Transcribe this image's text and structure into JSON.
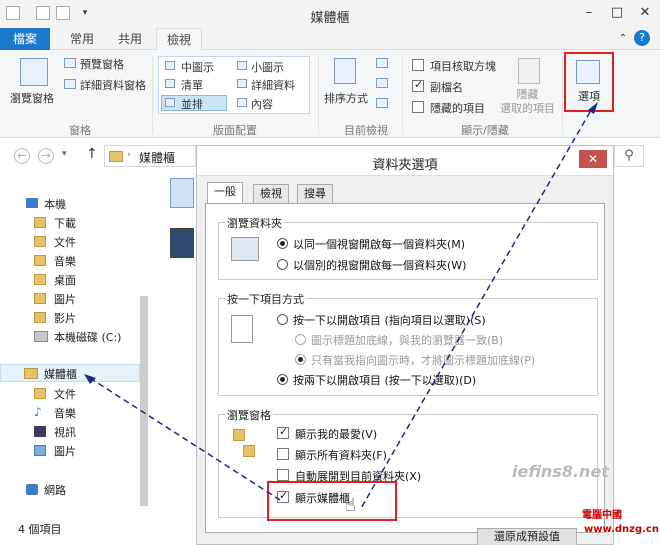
{
  "window": {
    "title": "媒體櫃"
  },
  "tabs": [
    "檔案",
    "常用",
    "共用",
    "檢視"
  ],
  "ribbon": {
    "panes": {
      "nav_pane": "瀏覽窗格",
      "preview_pane": "預覽窗格",
      "details_pane": "詳細資料窗格",
      "group": "窗格"
    },
    "layout": {
      "medium_icons": "中圖示",
      "small_icons": "小圖示",
      "list": "清單",
      "details": "詳細資料",
      "tiles": "並排",
      "content": "內容",
      "group": "版面配置"
    },
    "current_view": {
      "sort_by": "排序方式",
      "group": "目前檢視"
    },
    "show_hide": {
      "item_checkboxes": "項目核取方塊",
      "file_extensions": "副檔名",
      "hidden_items": "隱藏的項目",
      "hide_selected": "隱藏\n選取的項目",
      "group": "顯示/隱藏"
    },
    "options": "選項",
    "item_checkboxes_checked": false,
    "file_extensions_checked": true,
    "hidden_items_checked": false
  },
  "address": {
    "path": "媒體櫃"
  },
  "nav": {
    "this_pc": "本機",
    "items": [
      "下載",
      "文件",
      "音樂",
      "桌面",
      "圖片",
      "影片",
      "本機磁碟 (C:)"
    ],
    "libraries": "媒體櫃",
    "lib_items": [
      "文件",
      "音樂",
      "視訊",
      "圖片"
    ],
    "network": "網路"
  },
  "status": {
    "count": "4 個項目"
  },
  "dialog": {
    "title": "資料夾選項",
    "close": "✕",
    "tabs": [
      "一般",
      "檢視",
      "搜尋"
    ],
    "browse": {
      "title": "瀏覽資料夾",
      "opt1": "以同一個視窗開啟每一個資料夾(M)",
      "opt2": "以個別的視窗開啟每一個資料夾(W)"
    },
    "click": {
      "title": "按一下項目方式",
      "opt1": "按一下以開啟項目 (指向項目以選取)(S)",
      "sub1": "圖示標題加底線，與我的瀏覽器一致(B)",
      "sub2": "只有當我指向圖示時，才將圖示標題加底線(P)",
      "opt2": "按兩下以開啟項目 (按一下以選取)(D)"
    },
    "nav_pane": {
      "title": "瀏覽窗格",
      "opt1": "顯示我的最愛(V)",
      "opt2": "顯示所有資料夾(F)",
      "opt3": "自動展開到目前資料夾(X)",
      "opt4": "顯示媒體櫃",
      "opt1_checked": true,
      "opt2_checked": false,
      "opt3_checked": false,
      "opt4_checked": true
    },
    "restore_defaults": "還原成預設值"
  },
  "watermark": {
    "site1": "iefins8.net",
    "site2": "電腦中國",
    "site3": "www.dnzg.cn"
  }
}
